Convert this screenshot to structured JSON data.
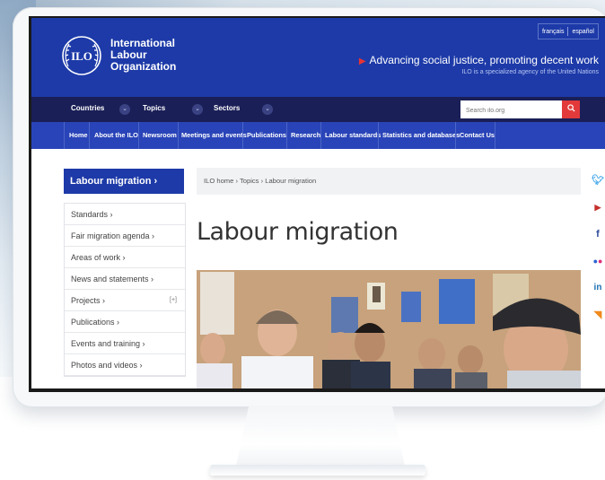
{
  "header": {
    "org_line1": "International",
    "org_line2": "Labour",
    "org_line3": "Organization",
    "lang_fr": "français",
    "lang_es": "español",
    "tagline": "Advancing social justice, promoting decent work",
    "subtagline": "ILO is a specialized agency of the United Nations"
  },
  "nav_primary": {
    "countries": "Countries",
    "topics": "Topics",
    "sectors": "Sectors",
    "search_placeholder": "Search ilo.org"
  },
  "nav_secondary": [
    "Home",
    "About the ILO",
    "Newsroom",
    "Meetings and events",
    "Publications",
    "Research",
    "Labour standards",
    "Statistics and databases",
    "Contact Us"
  ],
  "sidebar": {
    "title": "Labour migration ›",
    "items": [
      {
        "label": "Standards ›",
        "expandable": false
      },
      {
        "label": "Fair migration agenda ›",
        "expandable": false
      },
      {
        "label": "Areas of work ›",
        "expandable": false
      },
      {
        "label": "News and statements ›",
        "expandable": false
      },
      {
        "label": "Projects ›",
        "expandable": true,
        "toggle": "[+]"
      },
      {
        "label": "Publications ›",
        "expandable": false
      },
      {
        "label": "Events and training ›",
        "expandable": false
      },
      {
        "label": "Photos and videos ›",
        "expandable": false
      }
    ]
  },
  "main": {
    "breadcrumb": "ILO home › Topics › Labour migration",
    "title": "Labour migration"
  },
  "social": [
    "twitter-icon",
    "youtube-icon",
    "facebook-icon",
    "flickr-icon",
    "linkedin-icon",
    "rss-icon"
  ],
  "colors": {
    "header_blue": "#1d3aa8",
    "nav_dark": "#1a1f57",
    "nav_blue": "#2944b8",
    "accent_red": "#e23a3a"
  }
}
